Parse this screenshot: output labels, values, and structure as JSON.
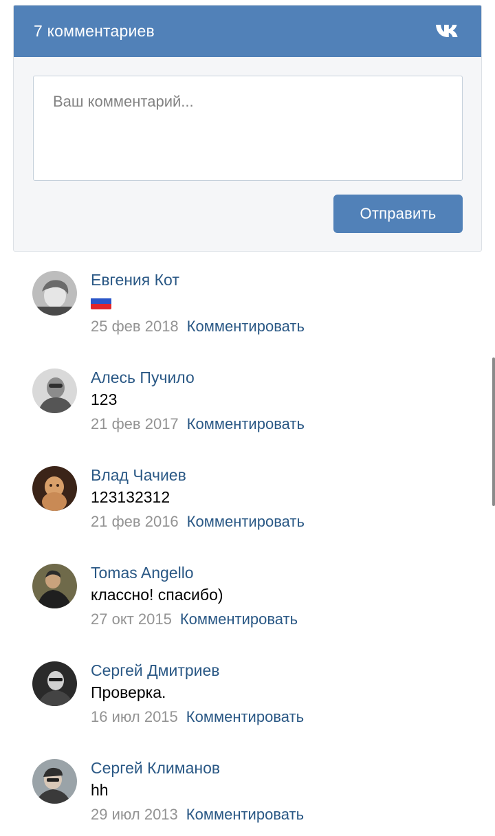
{
  "header": {
    "title": "7 комментариев",
    "logo_icon": "vk-logo-icon"
  },
  "form": {
    "placeholder": "Ваш комментарий...",
    "send_label": "Отправить"
  },
  "colors": {
    "brand": "#5181b8",
    "link": "#2a5885",
    "muted": "#939393"
  },
  "comments": [
    {
      "author": "Евгения Кот",
      "text": "🇷🇺",
      "text_is_flag": true,
      "date": "25 фев 2018",
      "reply_label": "Комментировать"
    },
    {
      "author": "Алесь Пучило",
      "text": "123",
      "date": "21 фев 2017",
      "reply_label": "Комментировать"
    },
    {
      "author": "Влад Чачиев",
      "text": "123132312",
      "date": "21 фев 2016",
      "reply_label": "Комментировать"
    },
    {
      "author": "Tomas Angello",
      "text": "классно! спасибо)",
      "date": "27 окт 2015",
      "reply_label": "Комментировать"
    },
    {
      "author": "Сергей Дмитриев",
      "text": "Проверка.",
      "date": "16 июл 2015",
      "reply_label": "Комментировать"
    },
    {
      "author": "Сергей Климанов",
      "text": "hh",
      "date": "29 июл 2013",
      "reply_label": "Комментировать"
    }
  ]
}
